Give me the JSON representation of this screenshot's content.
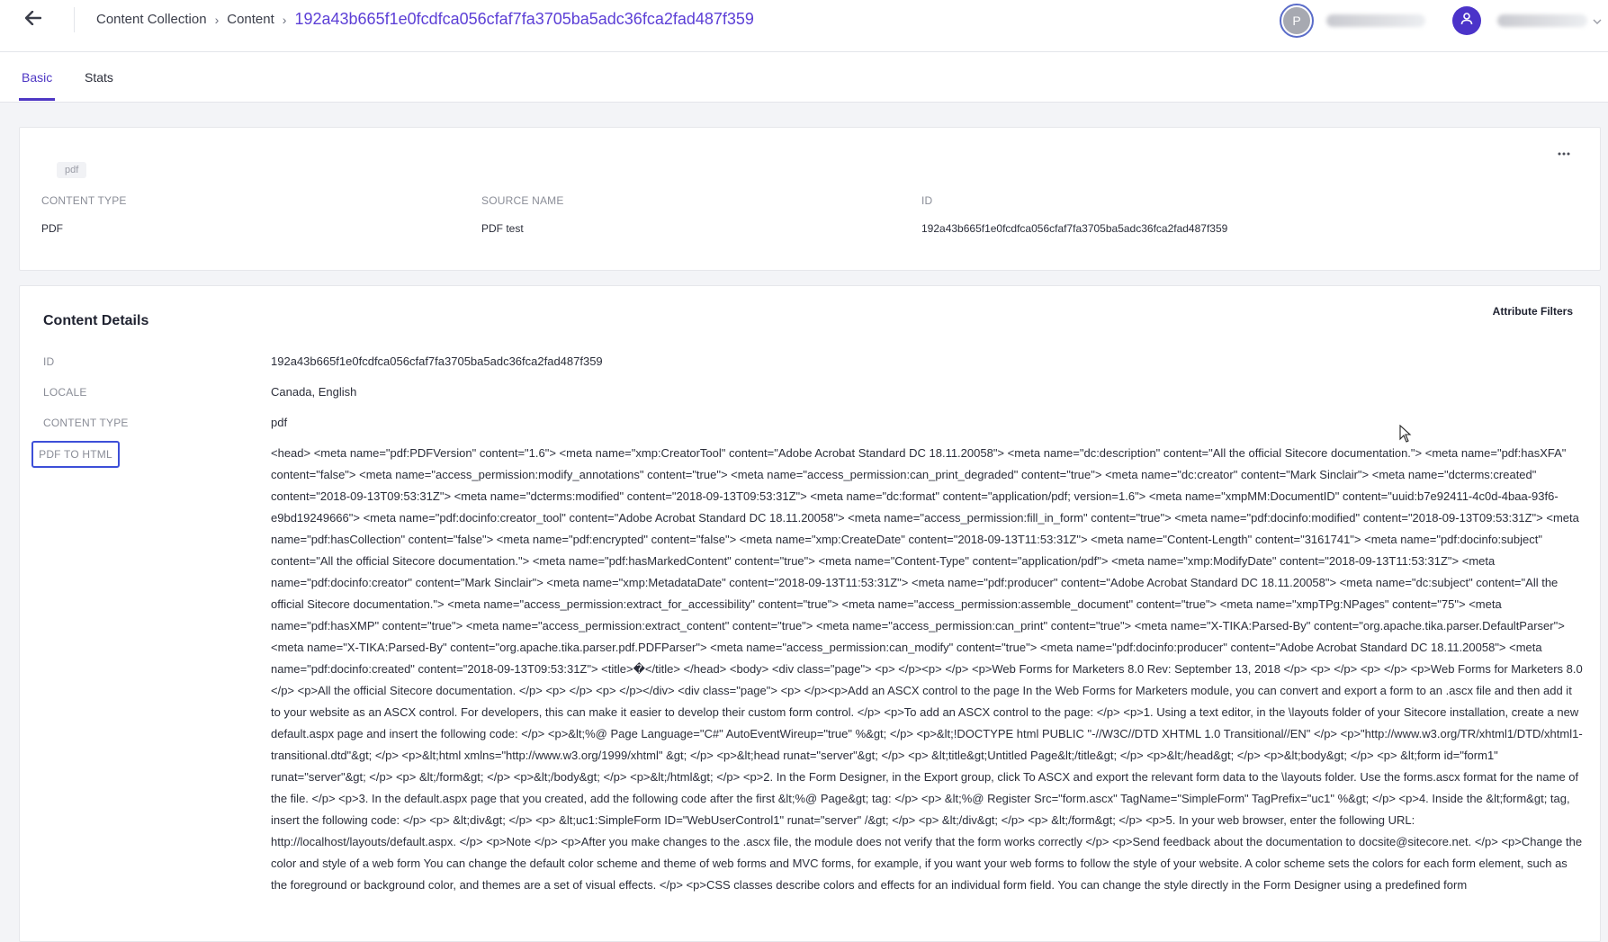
{
  "header": {
    "breadcrumb": [
      "Content Collection",
      "Content"
    ],
    "current_id": "192a43b665f1e0fcdfca056cfaf7fa3705ba5adc36fca2fad487f359",
    "avatar_initial": "P",
    "back_icon": "arrow-left-icon",
    "user_icon": "user-icon"
  },
  "tabs": [
    {
      "label": "Basic",
      "active": true
    },
    {
      "label": "Stats",
      "active": false
    }
  ],
  "summary": {
    "tag": "pdf",
    "content_type_label": "CONTENT TYPE",
    "content_type_value": "PDF",
    "source_name_label": "SOURCE NAME",
    "source_name_value": "PDF test",
    "id_label": "ID",
    "id_value": "192a43b665f1e0fcdfca056cfaf7fa3705ba5adc36fca2fad487f359",
    "more_icon": "more-horizontal-icon"
  },
  "details": {
    "title": "Content Details",
    "attribute_filters": "Attribute Filters",
    "rows": [
      {
        "label": "ID",
        "value": "192a43b665f1e0fcdfca056cfaf7fa3705ba5adc36fca2fad487f359"
      },
      {
        "label": "LOCALE",
        "value": "Canada, English"
      },
      {
        "label": "CONTENT TYPE",
        "value": "pdf"
      }
    ],
    "pdf_label": "PDF TO HTML",
    "pdf_html": "<head> <meta name=\"pdf:PDFVersion\" content=\"1.6\"> <meta name=\"xmp:CreatorTool\" content=\"Adobe Acrobat Standard DC 18.11.20058\"> <meta name=\"dc:description\" content=\"All the official Sitecore documentation.\"> <meta name=\"pdf:hasXFA\" content=\"false\"> <meta name=\"access_permission:modify_annotations\" content=\"true\"> <meta name=\"access_permission:can_print_degraded\" content=\"true\"> <meta name=\"dc:creator\" content=\"Mark Sinclair\"> <meta name=\"dcterms:created\" content=\"2018-09-13T09:53:31Z\"> <meta name=\"dcterms:modified\" content=\"2018-09-13T09:53:31Z\"> <meta name=\"dc:format\" content=\"application/pdf; version=1.6\"> <meta name=\"xmpMM:DocumentID\" content=\"uuid:b7e92411-4c0d-4baa-93f6-e9bd19249666\"> <meta name=\"pdf:docinfo:creator_tool\" content=\"Adobe Acrobat Standard DC 18.11.20058\"> <meta name=\"access_permission:fill_in_form\" content=\"true\"> <meta name=\"pdf:docinfo:modified\" content=\"2018-09-13T09:53:31Z\"> <meta name=\"pdf:hasCollection\" content=\"false\"> <meta name=\"pdf:encrypted\" content=\"false\"> <meta name=\"xmp:CreateDate\" content=\"2018-09-13T11:53:31Z\"> <meta name=\"Content-Length\" content=\"3161741\"> <meta name=\"pdf:docinfo:subject\" content=\"All the official Sitecore documentation.\"> <meta name=\"pdf:hasMarkedContent\" content=\"true\"> <meta name=\"Content-Type\" content=\"application/pdf\"> <meta name=\"xmp:ModifyDate\" content=\"2018-09-13T11:53:31Z\"> <meta name=\"pdf:docinfo:creator\" content=\"Mark Sinclair\"> <meta name=\"xmp:MetadataDate\" content=\"2018-09-13T11:53:31Z\"> <meta name=\"pdf:producer\" content=\"Adobe Acrobat Standard DC 18.11.20058\"> <meta name=\"dc:subject\" content=\"All the official Sitecore documentation.\"> <meta name=\"access_permission:extract_for_accessibility\" content=\"true\"> <meta name=\"access_permission:assemble_document\" content=\"true\"> <meta name=\"xmpTPg:NPages\" content=\"75\"> <meta name=\"pdf:hasXMP\" content=\"true\"> <meta name=\"access_permission:extract_content\" content=\"true\"> <meta name=\"access_permission:can_print\" content=\"true\"> <meta name=\"X-TIKA:Parsed-By\" content=\"org.apache.tika.parser.DefaultParser\"> <meta name=\"X-TIKA:Parsed-By\" content=\"org.apache.tika.parser.pdf.PDFParser\"> <meta name=\"access_permission:can_modify\" content=\"true\"> <meta name=\"pdf:docinfo:producer\" content=\"Adobe Acrobat Standard DC 18.11.20058\"> <meta name=\"pdf:docinfo:created\" content=\"2018-09-13T09:53:31Z\"> <title>�</title> </head> <body> <div class=\"page\"> <p> </p><p> </p> <p>Web Forms for Marketers 8.0 Rev: September 13, 2018 </p> <p> </p> <p> </p> <p>Web Forms for Marketers 8.0 </p> <p>All the official Sitecore documentation. </p> <p> </p> <p> </p></div> <div class=\"page\"> <p> </p><p>Add an ASCX control to the page In the Web Forms for Marketers module, you can convert and export a form to an .ascx file and then add it to your website as an ASCX control. For developers, this can make it easier to develop their custom form control. </p> <p>To add an ASCX control to the page: </p> <p>1. Using a text editor, in the \\layouts folder of your Sitecore installation, create a new default.aspx page and insert the following code: </p> <p>&lt;%@ Page Language=\"C#\" AutoEventWireup=\"true\" %&gt; </p> <p>&lt;!DOCTYPE html PUBLIC \"-//W3C//DTD XHTML 1.0 Transitional//EN\" </p> <p>\"http://www.w3.org/TR/xhtml1/DTD/xhtml1-transitional.dtd\"&gt; </p> <p>&lt;html xmlns=\"http://www.w3.org/1999/xhtml\" &gt; </p> <p>&lt;head runat=\"server\"&gt; </p> <p> &lt;title&gt;Untitled Page&lt;/title&gt; </p> <p>&lt;/head&gt; </p> <p>&lt;body&gt; </p> <p> &lt;form id=\"form1\" runat=\"server\"&gt; </p> <p> &lt;/form&gt; </p> <p>&lt;/body&gt; </p> <p>&lt;/html&gt; </p> <p>2. In the Form Designer, in the Export group, click To ASCX and export the relevant form data to the \\layouts folder. Use the forms.ascx format for the name of the file. </p> <p>3. In the default.aspx page that you created, add the following code after the first &lt;%@ Page&gt; tag: </p> <p> &lt;%@ Register Src=\"form.ascx\" TagName=\"SimpleForm\" TagPrefix=\"uc1\" %&gt; </p> <p>4. Inside the &lt;form&gt; tag, insert the following code: </p> <p> &lt;div&gt; </p> <p> &lt;uc1:SimpleForm ID=\"WebUserControl1\" runat=\"server\" /&gt; </p> <p> &lt;/div&gt; </p> <p> &lt;/form&gt; </p> <p>5. In your web browser, enter the following URL: http://localhost/layouts/default.aspx. </p> <p>Note </p> <p>After you make changes to the .ascx file, the module does not verify that the form works correctly </p> <p>Send feedback about the documentation to docsite@sitecore.net. </p> <p>Change the color and style of a web form You can change the default color scheme and theme of web forms and MVC forms, for example, if you want your web forms to follow the style of your website. A color scheme sets the colors for each form element, such as the foreground or background color, and themes are a set of visual effects. </p> <p>CSS classes describe colors and effects for an individual form field. You can change the style directly in the Form Designer using a predefined form"
  }
}
